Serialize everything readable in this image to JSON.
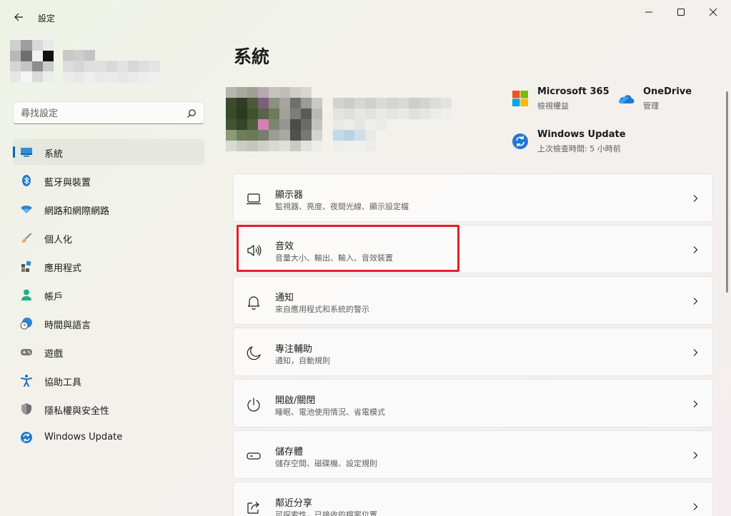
{
  "window": {
    "title": "設定"
  },
  "search": {
    "placeholder": "尋找設定"
  },
  "sidebar": {
    "items": [
      {
        "label": "系統",
        "icon": "monitor-icon",
        "active": true
      },
      {
        "label": "藍牙與裝置",
        "icon": "bluetooth-icon"
      },
      {
        "label": "網路和網際網路",
        "icon": "wifi-icon"
      },
      {
        "label": "個人化",
        "icon": "brush-icon"
      },
      {
        "label": "應用程式",
        "icon": "apps-icon"
      },
      {
        "label": "帳戶",
        "icon": "person-icon"
      },
      {
        "label": "時間與語言",
        "icon": "globe-clock-icon"
      },
      {
        "label": "遊戲",
        "icon": "gamepad-icon"
      },
      {
        "label": "協助工具",
        "icon": "accessibility-icon"
      },
      {
        "label": "隱私權與安全性",
        "icon": "shield-icon"
      },
      {
        "label": "Windows Update",
        "icon": "update-icon"
      }
    ]
  },
  "main": {
    "title": "系統",
    "quick_links": [
      {
        "title": "Microsoft 365",
        "sub": "檢視權益",
        "icon": "microsoft-logo-icon"
      },
      {
        "title": "OneDrive",
        "sub": "管理",
        "icon": "onedrive-icon"
      },
      {
        "title": "Windows Update",
        "sub": "上次檢查時間: 5 小時前",
        "icon": "update-icon"
      }
    ],
    "cards": [
      {
        "title": "顯示器",
        "sub": "監視器、亮度、夜間光線、顯示設定檔",
        "icon": "display-icon"
      },
      {
        "title": "音效",
        "sub": "音量大小、輸出、輸入、音效裝置",
        "icon": "speaker-icon"
      },
      {
        "title": "通知",
        "sub": "來自應用程式和系統的警示",
        "icon": "bell-icon"
      },
      {
        "title": "專注輔助",
        "sub": "通知，自動規則",
        "icon": "moon-icon"
      },
      {
        "title": "開啟/關閉",
        "sub": "睡眠、電池使用情況、省電模式",
        "icon": "power-icon"
      },
      {
        "title": "儲存體",
        "sub": "儲存空間、磁碟機、設定規則",
        "icon": "storage-icon"
      },
      {
        "title": "鄰近分享",
        "sub": "可探索性，已接收的檔案位置",
        "icon": "share-icon"
      }
    ]
  },
  "colors": {
    "accent": "#0067c0",
    "highlight": "#e4202b"
  }
}
